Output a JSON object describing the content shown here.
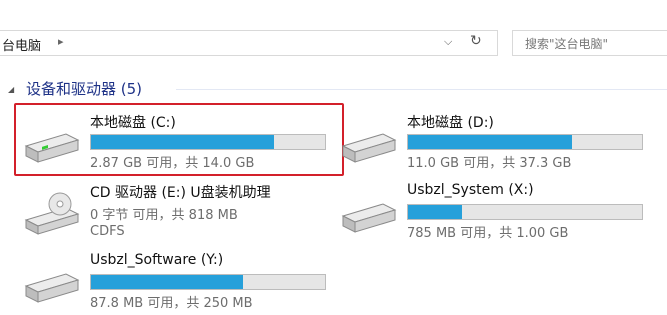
{
  "address": {
    "path": "台电脑",
    "separator": "▸",
    "dropdown": "⌵",
    "refresh": "↻"
  },
  "search": {
    "placeholder": "搜索\"这台电脑\""
  },
  "group": {
    "caret": "◢",
    "title": "设备和驱动器 (5)"
  },
  "drives": [
    {
      "name": "本地磁盘 (C:)",
      "usage": 0.78,
      "free_text": "2.87 GB 可用，共 14.0 GB"
    },
    {
      "name": "本地磁盘 (D:)",
      "usage": 0.7,
      "free_text": "11.0 GB 可用，共 37.3 GB"
    },
    {
      "name": "CD 驱动器 (E:) U盘装机助理",
      "free_text": "0 字节 可用，共 818 MB",
      "fs": "CDFS"
    },
    {
      "name": "Usbzl_System (X:)",
      "usage": 0.23,
      "free_text": "785 MB 可用，共 1.00 GB"
    },
    {
      "name": "Usbzl_Software (Y:)",
      "usage": 0.65,
      "free_text": "87.8 MB 可用，共 250 MB"
    }
  ],
  "colors": {
    "usage_bar": "#26a0da",
    "highlight": "#d3202a",
    "group_title": "#1e3287"
  }
}
